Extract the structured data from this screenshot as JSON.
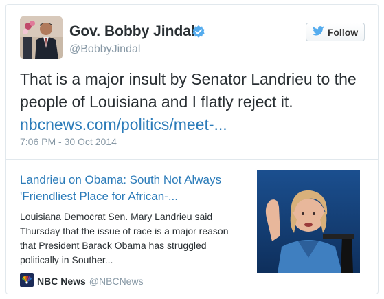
{
  "author": {
    "name": "Gov. Bobby Jindal",
    "handle": "@BobbyJindal",
    "verified_icon": "verified-badge-icon",
    "avatar": "profile photo of man in suit"
  },
  "follow_button": {
    "label": "Follow",
    "icon": "twitter-bird-icon"
  },
  "tweet": {
    "text": "That is a major insult by Senator Landrieu to the people of Louisiana and I flatly reject it. ",
    "link_text": "nbcnews.com/politics/meet-...",
    "timestamp": "7:06 PM - 30 Oct 2014"
  },
  "link_card": {
    "title": "Landrieu on Obama: South Not Always 'Friendliest Place for African-...",
    "description": "Louisiana Democrat Sen. Mary Landrieu said Thursday that the issue of race is a major reason that President Barack Obama has struggled politically in Souther...",
    "source_name": "NBC News",
    "source_handle": "@NBCNews",
    "source_icon": "nbc-peacock-icon",
    "image": "photo of woman speaking at podium"
  },
  "colors": {
    "link_blue": "#2b7bb9",
    "muted_gray": "#8899a6",
    "verified_blue": "#55acee",
    "border": "#e1e8ed"
  }
}
